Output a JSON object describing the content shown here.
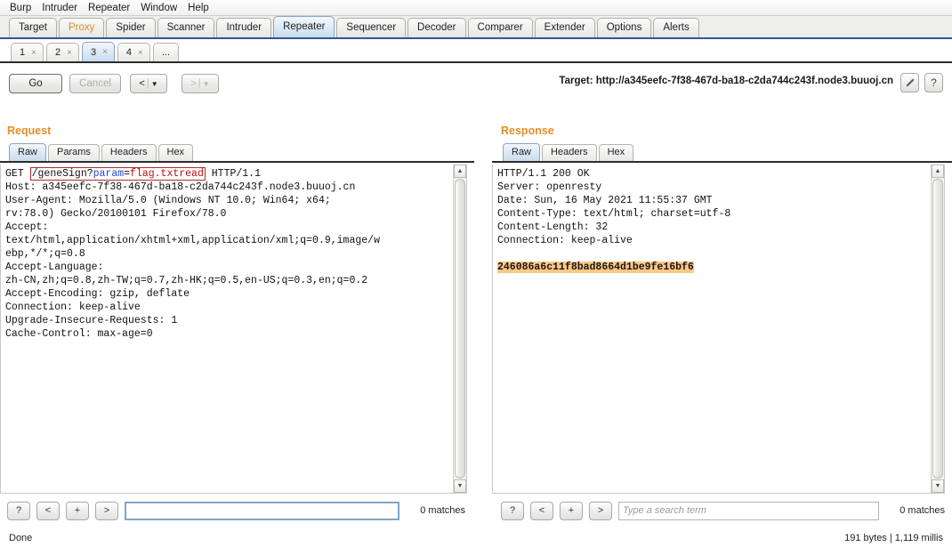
{
  "menu": {
    "items": [
      "Burp",
      "Intruder",
      "Repeater",
      "Window",
      "Help"
    ]
  },
  "main_tabs": [
    {
      "label": "Target",
      "state": "normal"
    },
    {
      "label": "Proxy",
      "state": "alert"
    },
    {
      "label": "Spider",
      "state": "normal"
    },
    {
      "label": "Scanner",
      "state": "normal"
    },
    {
      "label": "Intruder",
      "state": "normal"
    },
    {
      "label": "Repeater",
      "state": "selected"
    },
    {
      "label": "Sequencer",
      "state": "normal"
    },
    {
      "label": "Decoder",
      "state": "normal"
    },
    {
      "label": "Comparer",
      "state": "normal"
    },
    {
      "label": "Extender",
      "state": "normal"
    },
    {
      "label": "Options",
      "state": "normal"
    },
    {
      "label": "Alerts",
      "state": "normal"
    }
  ],
  "repeater_tabs": [
    {
      "label": "1",
      "close": "×",
      "state": "normal"
    },
    {
      "label": "2",
      "close": "×",
      "state": "normal"
    },
    {
      "label": "3",
      "close": "×",
      "state": "selected"
    },
    {
      "label": "4",
      "close": "×",
      "state": "normal"
    },
    {
      "label": "...",
      "close": "",
      "state": "normal"
    }
  ],
  "toolbar": {
    "go_label": "Go",
    "cancel_label": "Cancel",
    "back_arrow": "<",
    "back_caret": "▼",
    "fwd_arrow": ">",
    "fwd_caret": "▼",
    "separator": "|",
    "target_label": "Target: http://a345eefc-7f38-467d-ba18-c2da744c243f.node3.buuoj.cn",
    "edit_icon": "pencil-icon",
    "help_label": "?"
  },
  "request": {
    "title": "Request",
    "tabs": [
      {
        "label": "Raw",
        "state": "selected"
      },
      {
        "label": "Params",
        "state": "normal"
      },
      {
        "label": "Headers",
        "state": "normal"
      },
      {
        "label": "Hex",
        "state": "normal"
      }
    ],
    "request_line": {
      "method": "GET ",
      "selected_path_prefix": "/geneSign?",
      "selected_param": "param",
      "selected_equals": "=",
      "selected_value": "flag.txtread",
      "version": " HTTP/1.1"
    },
    "headers_text": "Host: a345eefc-7f38-467d-ba18-c2da744c243f.node3.buuoj.cn\nUser-Agent: Mozilla/5.0 (Windows NT 10.0; Win64; x64;\nrv:78.0) Gecko/20100101 Firefox/78.0\nAccept:\ntext/html,application/xhtml+xml,application/xml;q=0.9,image/w\nebp,*/*;q=0.8\nAccept-Language:\nzh-CN,zh;q=0.8,zh-TW;q=0.7,zh-HK;q=0.5,en-US;q=0.3,en;q=0.2\nAccept-Encoding: gzip, deflate\nConnection: keep-alive\nUpgrade-Insecure-Requests: 1\nCache-Control: max-age=0",
    "search": {
      "value": "",
      "placeholder": "",
      "matches": "0 matches",
      "buttons": [
        "?",
        "<",
        "+",
        ">"
      ]
    }
  },
  "response": {
    "title": "Response",
    "tabs": [
      {
        "label": "Raw",
        "state": "selected"
      },
      {
        "label": "Headers",
        "state": "normal"
      },
      {
        "label": "Hex",
        "state": "normal"
      }
    ],
    "headers_text": "HTTP/1.1 200 OK\nServer: openresty\nDate: Sun, 16 May 2021 11:55:37 GMT\nContent-Type: text/html; charset=utf-8\nContent-Length: 32\nConnection: keep-alive",
    "body_highlight": "246086a6c11f8bad8664d1be9fe16bf6",
    "search": {
      "value": "",
      "placeholder": "Type a search term",
      "matches": "0 matches",
      "buttons": [
        "?",
        "<",
        "+",
        ">"
      ]
    },
    "stats": "191 bytes | 1,119 millis"
  },
  "status": {
    "text": "Done"
  },
  "colors": {
    "accent_orange": "#e58e26",
    "tab_selected_blue": "#c7dcf0",
    "highlight_orange": "#fdc886",
    "selection_red": "#b52626",
    "param_blue": "#2a43d6",
    "value_red": "#b31212"
  }
}
